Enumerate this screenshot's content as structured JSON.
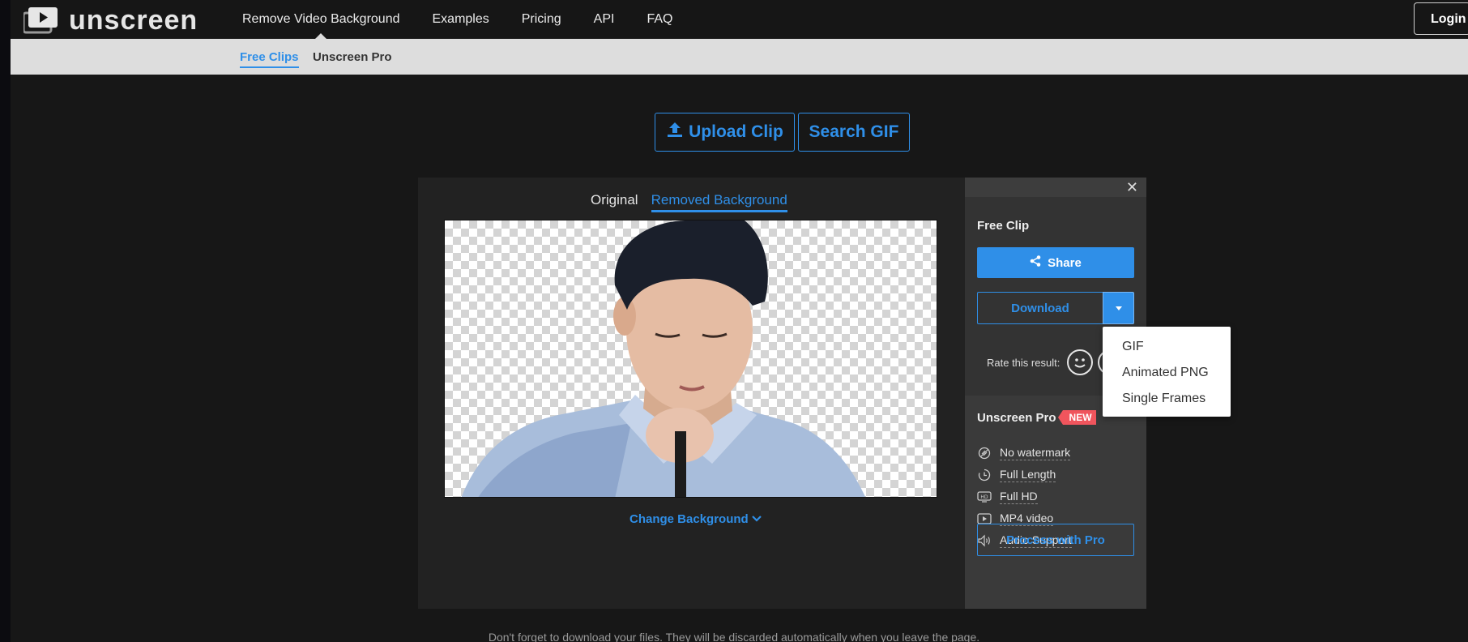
{
  "brand": {
    "name": "unscreen"
  },
  "nav": {
    "links": [
      "Remove Video Background",
      "Examples",
      "Pricing",
      "API",
      "FAQ"
    ],
    "login_label": "Login"
  },
  "subnav": {
    "tabs": [
      "Free Clips",
      "Unscreen Pro"
    ],
    "active": "Free Clips"
  },
  "actions": {
    "upload_label": "Upload Clip",
    "search_label": "Search GIF"
  },
  "viewer": {
    "tabs": [
      "Original",
      "Removed Background"
    ],
    "active_tab": "Removed Background",
    "change_background_label": "Change Background"
  },
  "side_panel": {
    "title": "Free Clip",
    "share_label": "Share",
    "download_label": "Download",
    "rate_label": "Rate this result:",
    "pro": {
      "title": "Unscreen Pro",
      "badge": "NEW",
      "features": [
        {
          "icon": "no-watermark-icon",
          "label": "No watermark"
        },
        {
          "icon": "clock-icon",
          "label": "Full Length"
        },
        {
          "icon": "hd-icon",
          "label": "Full HD"
        },
        {
          "icon": "video-icon",
          "label": "MP4 video"
        },
        {
          "icon": "speaker-icon",
          "label": "Audio Support"
        }
      ],
      "process_label": "Process with Pro"
    }
  },
  "download_menu": {
    "items": [
      "GIF",
      "Animated PNG",
      "Single Frames"
    ]
  },
  "footer": {
    "note": "Don't forget to download your files. They will be discarded automatically when you leave the page."
  },
  "colors": {
    "accent": "#2f8fe8",
    "badge": "#f0555d",
    "background": "#171717"
  }
}
